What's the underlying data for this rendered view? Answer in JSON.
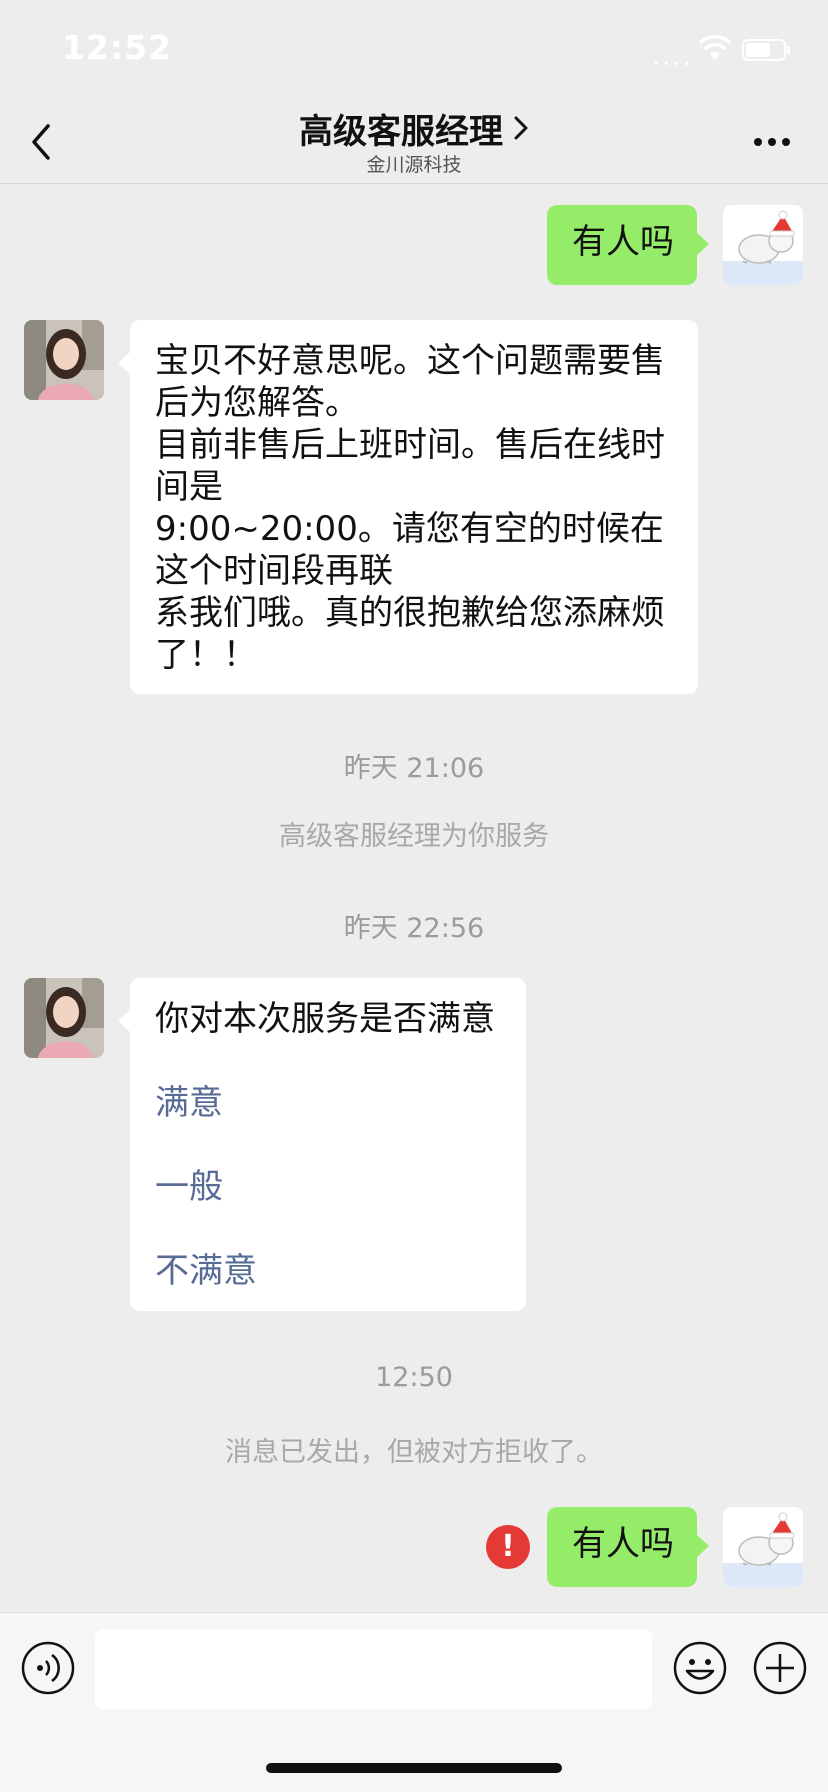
{
  "status_bar": {
    "time": "12:52",
    "signal_dots": "...."
  },
  "nav": {
    "title": "高级客服经理",
    "subtitle": "金川源科技"
  },
  "messages": {
    "m1": {
      "text": "有人吗"
    },
    "m2": {
      "lines": [
        "宝贝不好意思呢。这个问题需要售",
        "后为您解答。",
        "目前非售后上班时间。售后在线时",
        "间是",
        "9:00~20:00。请您有空的时候在",
        "这个时间段再联",
        "系我们哦。真的很抱歉给您添麻烦",
        "了！！"
      ]
    },
    "time1": "昨天 21:06",
    "system1": "高级客服经理为你服务",
    "time2": "昨天 22:56",
    "m3": {
      "question": "你对本次服务是否满意",
      "options": [
        "满意",
        "一般",
        "不满意"
      ]
    },
    "time3": "12:50",
    "system2": "消息已发出，但被对方拒收了。",
    "m4": {
      "text": "有人吗",
      "error_mark": "!"
    }
  },
  "input": {
    "value": "",
    "placeholder": ""
  },
  "icons": {
    "back": "chevron-left-icon",
    "title_chevron": "chevron-right-icon",
    "more": "more-dots-icon",
    "voice": "voice-icon",
    "emoji": "emoji-icon",
    "plus": "plus-icon",
    "error": "error-icon"
  },
  "colors": {
    "background": "#ededed",
    "bubble_self": "#95ec69",
    "bubble_other": "#ffffff",
    "link": "#576b95",
    "error": "#e53935"
  }
}
